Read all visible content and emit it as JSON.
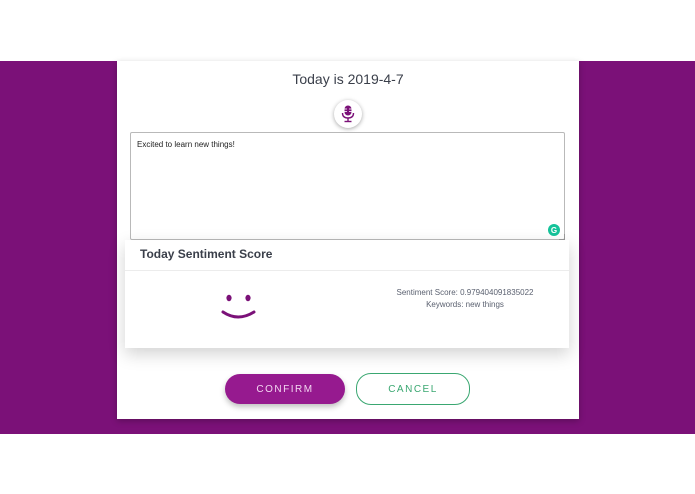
{
  "header": {
    "title": "Today is 2019-4-7"
  },
  "mic": {
    "icon": "microphone-icon",
    "color": "#7b1178"
  },
  "entry": {
    "value": "Excited to learn new things!"
  },
  "grammarly": {
    "glyph": "G",
    "color": "#15c39a"
  },
  "sentiment": {
    "title": "Today Sentiment Score",
    "face": "smiley-face-icon",
    "score_text": "Sentiment Score: 0.979404091835022",
    "keywords_text": "Keywords: new things"
  },
  "actions": {
    "confirm_label": "CONFIRM",
    "cancel_label": "CANCEL"
  },
  "colors": {
    "background": "#7b1178",
    "accent": "#961a8f",
    "cancel": "#3aa771"
  }
}
